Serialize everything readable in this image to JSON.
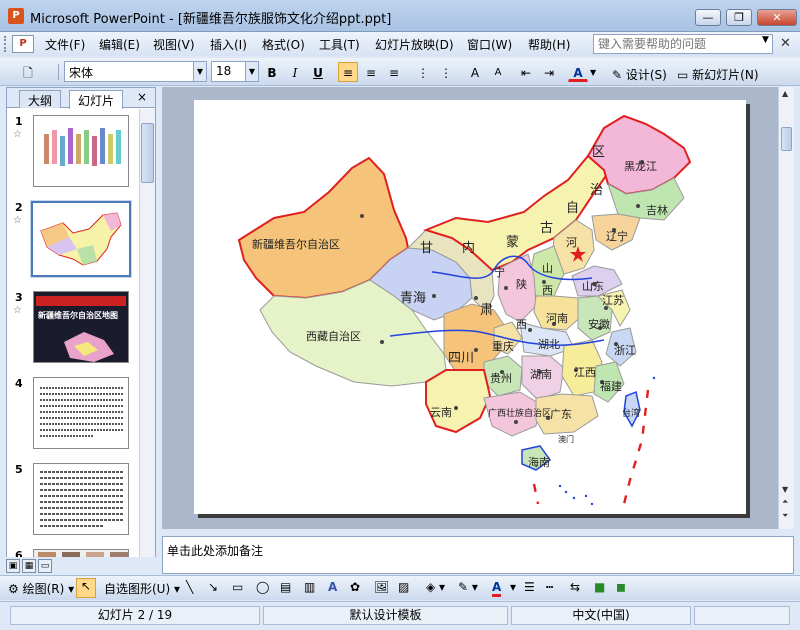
{
  "window": {
    "app_name": "Microsoft PowerPoint",
    "title": "Microsoft PowerPoint - [新疆维吾尔族服饰文化介绍ppt.ppt]",
    "buttons": {
      "minimize": "—",
      "restore": "❐",
      "close": "✕"
    }
  },
  "menubar": {
    "items": [
      "文件(F)",
      "编辑(E)",
      "视图(V)",
      "插入(I)",
      "格式(O)",
      "工具(T)",
      "幻灯片放映(D)",
      "窗口(W)",
      "帮助(H)"
    ],
    "help_placeholder": "键入需要帮助的问题"
  },
  "toolbar": {
    "font_name": "宋体",
    "font_size": "18",
    "bold": "B",
    "italic": "I",
    "underline": "U",
    "design_label": "设计(S)",
    "new_slide_label": "新幻灯片(N)"
  },
  "leftpane": {
    "tabs": [
      "大纲",
      "幻灯片"
    ],
    "close": "×",
    "slides": [
      {
        "num": "1",
        "selected": false
      },
      {
        "num": "2",
        "selected": true
      },
      {
        "num": "3",
        "selected": false,
        "text": "新疆维吾尔自治区地图"
      },
      {
        "num": "4",
        "selected": false
      },
      {
        "num": "5",
        "selected": false
      },
      {
        "num": "6",
        "selected": false
      }
    ]
  },
  "map": {
    "labels": {
      "heilongjiang": "黑龙江",
      "jilin": "吉林",
      "liaoning": "辽宁",
      "xinjiang": "新疆维吾尔自治区",
      "xizang": "西藏自治区",
      "qinghai": "青海",
      "gansu": "甘",
      "su": "肃",
      "nei": "内",
      "meng": "蒙",
      "gu": "古",
      "zi": "自",
      "zhi": "治",
      "qu": "区",
      "ningxia": "宁",
      "shanxi_a": "山",
      "shanxi_b": "西",
      "shaanxi_a": "陕",
      "shaanxi_b": "西",
      "henan": "河南",
      "hebei": "河",
      "shandong": "山东",
      "sichuan": "四川",
      "chongqing": "重庆",
      "hubei": "湖北",
      "hunan": "湖南",
      "guizhou": "贵州",
      "yunnan": "云南",
      "guangxi": "广西壮族自治区",
      "guangdong": "广东",
      "jiangxi": "江西",
      "fujian": "福建",
      "zhejiang": "浙江",
      "anhui": "安徽",
      "jiangsu": "江苏",
      "hainan": "海南",
      "taiwan": "台湾",
      "aomen": "澳门"
    }
  },
  "notes": {
    "placeholder": "单击此处添加备注"
  },
  "drawbar": {
    "draw_label": "绘图(R)",
    "autoshapes_label": "自选图形(U)"
  },
  "statusbar": {
    "slide_info": "幻灯片 2 / 19",
    "template": "默认设计模板",
    "language": "中文(中国)"
  },
  "colors": {
    "accent": "#4a78bb",
    "border_red": "#e02020",
    "river_blue": "#2244dd",
    "capital_star": "#e02020"
  }
}
